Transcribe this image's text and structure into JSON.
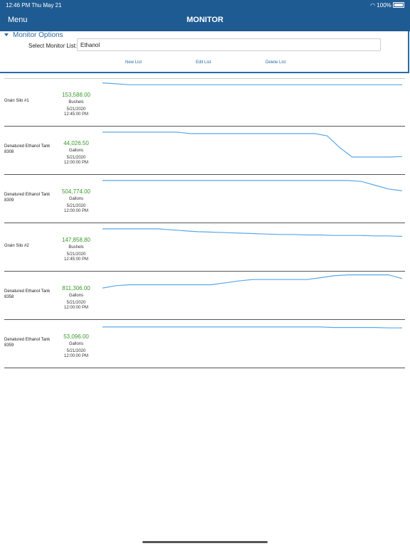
{
  "status_bar": {
    "time_date": "12:46 PM   Thu May 21",
    "battery": "100%"
  },
  "nav": {
    "menu": "Menu",
    "title": "MONITOR"
  },
  "options": {
    "header": "Monitor Options",
    "select_label": "Select Monitor List:",
    "select_value": "Ethanol",
    "new_list": "New List",
    "edit_list": "Edit List",
    "delete_list": "Delete List"
  },
  "colors": {
    "header": "#1f5b93",
    "accent": "#2b6aa6",
    "value": "#3a9a2a",
    "line": "#5aa8e6"
  },
  "rows": [
    {
      "name": "Grain Silo #1",
      "value": "153,588.00",
      "unit": "Bushels",
      "date": "5/21/2020",
      "time": "12:45:00 PM",
      "trend": [
        0.1,
        0.12,
        0.14,
        0.14,
        0.14,
        0.14,
        0.14,
        0.14,
        0.14,
        0.14,
        0.14,
        0.14,
        0.14,
        0.14,
        0.14,
        0.14,
        0.14,
        0.14,
        0.14,
        0.14,
        0.14,
        0.14,
        0.14
      ]
    },
    {
      "name": "Denatured Ethanol Tank 8308",
      "value": "44,026.50",
      "unit": "Gallons",
      "date": "5/21/2020",
      "time": "12:00:00 PM",
      "trend": [
        0.12,
        0.12,
        0.12,
        0.12,
        0.12,
        0.12,
        0.12,
        0.15,
        0.15,
        0.15,
        0.15,
        0.15,
        0.15,
        0.15,
        0.15,
        0.15,
        0.15,
        0.15,
        0.2,
        0.45,
        0.65,
        0.65,
        0.65,
        0.65,
        0.64
      ]
    },
    {
      "name": "Denatured Ethanol Tank 8309",
      "value": "504,774.00",
      "unit": "Gallons",
      "date": "5/21/2020",
      "time": "12:00:00 PM",
      "trend": [
        0.12,
        0.12,
        0.12,
        0.12,
        0.12,
        0.12,
        0.12,
        0.12,
        0.12,
        0.12,
        0.12,
        0.12,
        0.12,
        0.12,
        0.12,
        0.12,
        0.12,
        0.12,
        0.12,
        0.14,
        0.22,
        0.3,
        0.34
      ]
    },
    {
      "name": "Grain Silo #2",
      "value": "147,858.80",
      "unit": "Bushels",
      "date": "5/21/2020",
      "time": "12:45:00 PM",
      "trend": [
        0.12,
        0.12,
        0.12,
        0.12,
        0.12,
        0.14,
        0.16,
        0.18,
        0.19,
        0.2,
        0.21,
        0.22,
        0.23,
        0.24,
        0.24,
        0.25,
        0.25,
        0.26,
        0.26,
        0.26,
        0.27,
        0.27,
        0.28
      ]
    },
    {
      "name": "Denatured Ethanol Tank 8358",
      "value": "811,306.00",
      "unit": "Gallons",
      "date": "5/21/2020",
      "time": "12:00:00 PM",
      "trend": [
        0.35,
        0.3,
        0.28,
        0.28,
        0.28,
        0.28,
        0.28,
        0.28,
        0.28,
        0.24,
        0.2,
        0.17,
        0.17,
        0.17,
        0.17,
        0.17,
        0.13,
        0.09,
        0.07,
        0.07,
        0.07,
        0.07,
        0.15
      ]
    },
    {
      "name": "Denatured Ethanol Tank 8359",
      "value": "53,096.00",
      "unit": "Gallons",
      "date": "5/21/2020",
      "time": "12:00:00 PM",
      "trend": [
        0.15,
        0.15,
        0.15,
        0.15,
        0.15,
        0.15,
        0.15,
        0.15,
        0.15,
        0.15,
        0.15,
        0.15,
        0.15,
        0.15,
        0.15,
        0.15,
        0.15,
        0.16,
        0.16,
        0.16,
        0.16,
        0.17,
        0.17
      ]
    }
  ]
}
